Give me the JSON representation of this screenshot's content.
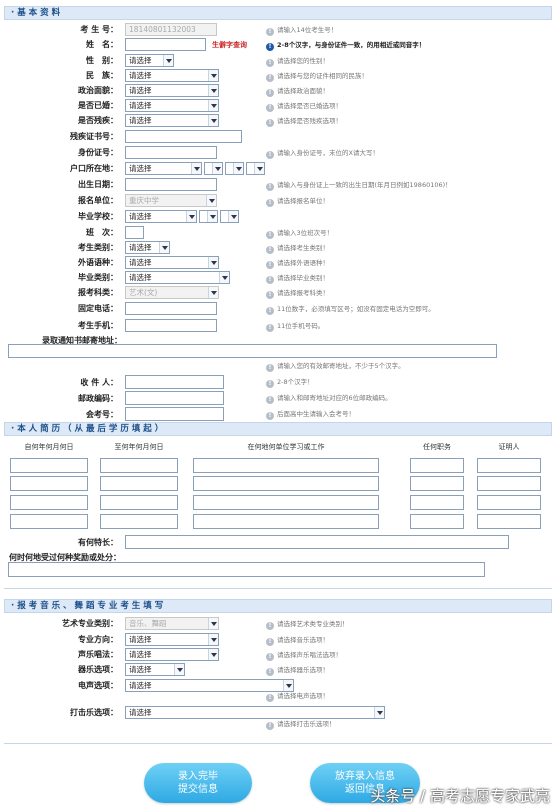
{
  "sec1_title": "· 基 本 资 料",
  "lbl_kh": "考 生 号：",
  "kh_value": "18140801132003",
  "kh_hint": "请输入14位考生号！",
  "lbl_xm": "姓　名：",
  "xm_link": "生僻字查询",
  "xm_hint": "2-8个汉字，与身份证件一致，的用相近或同音字！",
  "lbl_xb": "性　别：",
  "xb_value": "请选择",
  "xb_hint": "请选择您的性别！",
  "lbl_mz": "民　族：",
  "mz_value": "请选择",
  "mz_hint": "请选择与您的证件相同的民族！",
  "lbl_zzmm": "政治面貌：",
  "zzmm_value": "请选择",
  "zzmm_hint": "请选择政治面貌！",
  "lbl_yh": "是否已婚：",
  "yh_value": "请选择",
  "yh_hint": "请选择是否已婚选项！",
  "lbl_cj": "是否残疾：",
  "cj_value": "请选择",
  "cj_hint": "请选择是否残疾选项！",
  "lbl_cjz": "残疾证书号：",
  "lbl_sfz": "身份证号：",
  "sfz_hint": "请输入身份证号，末位的X请大写！",
  "lbl_hk": "户口所在地：",
  "hk_value": "请选择",
  "hk_v2": "",
  "hk_v3": "",
  "hk_v4": "",
  "lbl_csrq": "出生日期：",
  "csrq_hint": "请输入与身份证上一致的出生日期(年月日例如19860106)！",
  "lbl_bmdw": "报名单位：",
  "bmdw_value": "重庆中学",
  "bmdw_hint": "请选择报名单位！",
  "lbl_byxx": "毕业学校：",
  "byxx_value": "请选择",
  "byxx_v2": "",
  "byxx_v3": "",
  "lbl_bc": "班　次：",
  "bc_hint": "请输入3位班次号！",
  "lbl_kslb": "考生类别：",
  "kslb_value": "请选择",
  "kslb_hint": "请选择考生类别！",
  "lbl_wyyz": "外语语种：",
  "wyyz_value": "请选择",
  "wyyz_hint": "请选择外语语种！",
  "lbl_bylb": "毕业类别：",
  "bylb_value": "请选择",
  "bylb_hint": "请选择毕业类别！",
  "lbl_bkkl": "报考科类：",
  "bkkl_value": "艺术(文)",
  "bkkl_hint": "请选择报考科类！",
  "lbl_gddh": "固定电话：",
  "gddh_hint": "11位数字，必须填写区号；如没有固定电话为空即可。",
  "lbl_sj": "考生手机：",
  "sj_hint": "11位手机号码。",
  "lbl_lq": "录取通知书邮寄地址：",
  "lq_hint": "请输入您的有效邮寄地址，不少于5个汉字。",
  "lbl_sjr": "收 件 人：",
  "sjr_hint": "2-8个汉字！",
  "lbl_yzbm": "邮政编码：",
  "yzbm_hint": "请输入和邮寄地址对应的6位邮政编码。",
  "lbl_hkh": "会考号：",
  "hkh_hint": "后面高中生请输入会考号！",
  "sec2_title": "· 本 人 简 历 （ 从 最 后 学 历 填 起 ）",
  "th_start": "自何年何月何日",
  "th_end": "至何年何月何日",
  "th_place": "在何地何单位学习或工作",
  "th_post": "任何职务",
  "th_witness": "证明人",
  "lbl_tc": "有何特长：",
  "lbl_jl": "何时何地受过何种奖励或处分：",
  "sec3_title": "· 报 考 音 乐 、 舞 蹈 专 业 考 生 填 写",
  "lbl_yslb": "艺术专业类别：",
  "yslb_value": "音乐、舞蹈",
  "yslb_hint": "请选择艺术类专业类别！",
  "lbl_zyfx": "专业方向：",
  "zyfx_value": "请选择",
  "zyfx_hint": "请选择音乐选项！",
  "lbl_sych": "声乐唱法：",
  "sych_value": "请选择",
  "sych_hint": "请选择声乐唱法选项！",
  "lbl_qyxx": "器乐选项：",
  "qyxx_value": "请选择",
  "qyxx_hint": "请选择器乐选项！",
  "lbl_dsxx": "电声选项：",
  "dsxx_value": "请选择",
  "dsxx_hint": "请选择电声选项！",
  "lbl_dj": "打击乐选项：",
  "dj_value": "请选择",
  "dj_hint": "请选择打击乐选项！",
  "btn_submit_1": "录入完毕",
  "btn_submit_2": "提交信息",
  "btn_cancel_1": "放弃录入信息",
  "btn_cancel_2": "返回信息",
  "watermark": "头条号 / 高考志愿专家武亮"
}
